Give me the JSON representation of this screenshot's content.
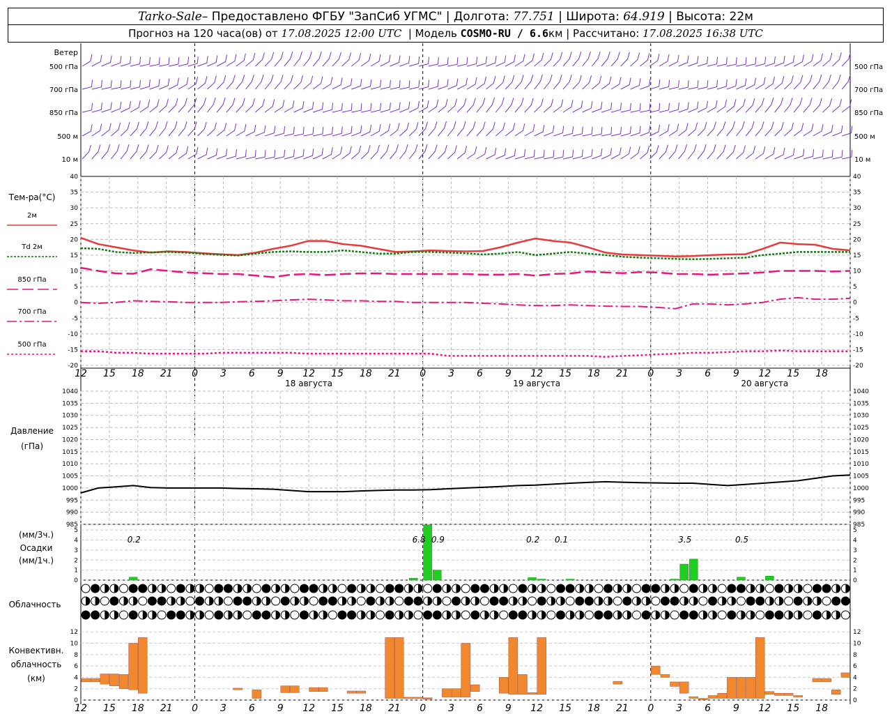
{
  "header": {
    "station": "Tarko-Sale",
    "provider": " – Предоставлено ФГБУ \"ЗапСиб УГМС\"",
    "lon_label": "Долгота:",
    "lon": "77.751",
    "lat_label": "Широта:",
    "lat": "64.919",
    "alt_label": "Высота:",
    "alt": "22м",
    "forecast_prefix": "Прогноз на 120 часа(ов) от",
    "forecast_time": "17.08.2025 12:00 UTC",
    "model_label": "Модель",
    "model": "COSMO-RU / 6.6",
    "model_unit": "км",
    "calc_label": "Рассчитано:",
    "calc_time": "17.08.2025 16:38 UTC"
  },
  "chart_data": [
    {
      "type": "wind-barbs",
      "title": "Ветер",
      "levels": [
        "500 гПа",
        "700 гПа",
        "850 гПа",
        "500 м",
        "10  м"
      ],
      "color": "#7733cc"
    },
    {
      "type": "line",
      "title": "Тем-ра(°C)",
      "ylim": [
        -20,
        40
      ],
      "yticks": [
        -20,
        -15,
        -10,
        -5,
        0,
        5,
        10,
        15,
        20,
        25,
        30,
        35,
        40
      ],
      "grid": true,
      "x_hours": [
        0,
        3,
        6,
        9,
        12,
        15,
        18,
        21,
        24,
        27,
        30,
        33,
        36,
        39,
        42,
        45,
        48,
        51,
        54,
        57,
        60,
        63,
        66,
        69,
        72,
        75,
        78,
        81,
        84,
        87,
        90,
        93,
        96,
        99,
        102,
        105,
        108,
        111,
        114,
        117,
        120
      ],
      "series": [
        {
          "name": "2м",
          "color": "#e83a3a",
          "values": [
            20.5,
            18.5,
            17.5,
            16.5,
            15.8,
            16.2,
            16,
            15.6,
            15.3,
            15,
            15.8,
            17,
            18,
            19.5,
            19.5,
            18.5,
            18,
            17,
            16,
            16.2,
            16.5,
            16.3,
            16.2,
            16.3,
            17.5,
            19,
            20.3,
            19.5,
            19,
            17.5,
            15.8,
            15.2,
            15,
            14.8,
            14.6,
            14.7,
            15,
            15.2,
            15.3,
            17,
            19,
            18.5,
            18.3,
            17,
            16.5
          ]
        },
        {
          "name": "Td  2м",
          "color": "#127a12",
          "values": [
            17.2,
            17,
            16,
            15.7,
            15.9,
            16,
            15.8,
            15.4,
            15.1,
            14.9,
            15.5,
            16,
            16.2,
            16,
            16,
            16.5,
            16,
            15.5,
            15.5,
            16,
            16,
            15.8,
            15.6,
            15.2,
            15.5,
            16,
            15,
            15.5,
            16,
            15.5,
            15,
            14.5,
            14.2,
            14,
            13.8,
            13.7,
            13.8,
            14,
            14.2,
            15,
            15.5,
            16,
            16,
            16,
            16
          ]
        },
        {
          "name": "850 гПа",
          "color": "#e8177f",
          "values": [
            11,
            10,
            9.2,
            9.1,
            10.5,
            10,
            9.5,
            9.3,
            9,
            9,
            8.5,
            8,
            8.8,
            9,
            8.7,
            9,
            9.2,
            9.2,
            9,
            9,
            9,
            9,
            9,
            8.8,
            8.8,
            9,
            8.5,
            9,
            9.2,
            9.8,
            9.5,
            9.3,
            9.6,
            9.5,
            9,
            9,
            8.8,
            9,
            9.2,
            9.5,
            10,
            10,
            10,
            9.8,
            10
          ]
        },
        {
          "name": "700 гПа",
          "color": "#e8177f",
          "values": [
            0,
            -0.3,
            0,
            0.5,
            0.3,
            0.2,
            0,
            0,
            0,
            0.2,
            0.3,
            0.5,
            0.8,
            1,
            0.8,
            0.5,
            0.5,
            0.3,
            0.3,
            0,
            0,
            0,
            0,
            -0.3,
            -0.5,
            -0.8,
            -1,
            -1,
            -0.8,
            -1,
            -1.2,
            -1.3,
            -1.3,
            -1.6,
            -2,
            -0.5,
            -0.5,
            -0.8,
            -0.5,
            0,
            1,
            1.5,
            1,
            1,
            1.3
          ]
        },
        {
          "name": "500 гПа",
          "color": "#e8177f",
          "values": [
            -15.5,
            -15.5,
            -16,
            -16,
            -16.3,
            -16.3,
            -16.3,
            -16.3,
            -16,
            -16,
            -16,
            -16,
            -16,
            -16.3,
            -16.3,
            -16.3,
            -16.3,
            -16.3,
            -16.3,
            -16.3,
            -16.3,
            -17,
            -17,
            -17,
            -17,
            -17,
            -17,
            -17,
            -17,
            -17,
            -17.3,
            -17,
            -16.8,
            -16.5,
            -16.3,
            -16,
            -16,
            -15.8,
            -15.5,
            -15.5,
            -15.3,
            -15.5,
            -15.5,
            -15.5,
            -15.5
          ]
        }
      ]
    },
    {
      "type": "line",
      "title": "Давление",
      "unit": "(гПа)",
      "ylim": [
        985,
        1040
      ],
      "yticks": [
        985,
        990,
        995,
        1000,
        1005,
        1010,
        1015,
        1020,
        1025,
        1030,
        1035,
        1040
      ],
      "grid": true,
      "series": [
        {
          "name": "Давление",
          "color": "#000000",
          "values": [
            998,
            1000,
            1000.5,
            1001,
            1000.2,
            1000,
            1000,
            1000,
            1000,
            999.8,
            999.7,
            999.5,
            999,
            998.5,
            998.5,
            998.5,
            998.8,
            999,
            999.2,
            999.2,
            999.3,
            999.7,
            1000,
            1000.3,
            1000.6,
            1001,
            1001.2,
            1001.6,
            1002,
            1002.3,
            1002.6,
            1002.4,
            1002.2,
            1002.1,
            1002,
            1002,
            1001.5,
            1001,
            1001.5,
            1002,
            1002.5,
            1003,
            1004,
            1005,
            1005.4
          ]
        }
      ]
    },
    {
      "type": "bar",
      "title": "Осадки",
      "unit_top": "(мм/3ч.)",
      "unit_bottom": "(мм/1ч.)",
      "ylim": [
        0,
        5.5
      ],
      "yticks": [
        0,
        1,
        2,
        3,
        4,
        5
      ],
      "color": "#22cc22",
      "bars": [
        [
          5,
          0.3
        ],
        [
          34.5,
          0.2
        ],
        [
          36,
          6.8
        ],
        [
          37,
          1
        ],
        [
          47,
          0.25
        ],
        [
          48,
          0.1
        ],
        [
          51,
          0.1
        ],
        [
          62,
          0.1
        ],
        [
          63,
          1.6
        ],
        [
          64,
          2.1
        ],
        [
          69,
          0.3
        ],
        [
          72,
          0.4
        ]
      ],
      "labels": [
        [
          "0.2",
          5.3
        ],
        [
          "6.8",
          35.3
        ],
        [
          "0.9",
          37.3
        ],
        [
          "0.2",
          47.3
        ],
        [
          "0.1",
          50.3
        ],
        [
          "3.5",
          63.3
        ],
        [
          "0.5",
          69.3
        ]
      ]
    },
    {
      "type": "symbols",
      "title": "Облачность"
    },
    {
      "type": "bar",
      "title": "Конвективн. облачность",
      "unit": "(км)",
      "ylim": [
        0,
        13.5
      ],
      "yticks": [
        0,
        2,
        4,
        6,
        8,
        10,
        12
      ],
      "color": "#f08830",
      "bars": [
        [
          0,
          3.2,
          3.8
        ],
        [
          1,
          3.2,
          3.8
        ],
        [
          2,
          2.8,
          4.6
        ],
        [
          3,
          2.5,
          4.6
        ],
        [
          4,
          2,
          4.5
        ],
        [
          5,
          1.8,
          10
        ],
        [
          6,
          1.2,
          11
        ],
        [
          16,
          1.8,
          2.1
        ],
        [
          18,
          0.3,
          1.8
        ],
        [
          21,
          1.3,
          2.5
        ],
        [
          22,
          1.3,
          2.5
        ],
        [
          24,
          1.5,
          2.2
        ],
        [
          25,
          1.5,
          2.2
        ],
        [
          28,
          1.2,
          1.6
        ],
        [
          29,
          1.2,
          1.6
        ],
        [
          32,
          0.3,
          11
        ],
        [
          33,
          0.3,
          11
        ],
        [
          34,
          0.3,
          0.5
        ],
        [
          35,
          0.3,
          0.5
        ],
        [
          36,
          0.3,
          0.4
        ],
        [
          38,
          0.5,
          2
        ],
        [
          39,
          0.5,
          2
        ],
        [
          40,
          0.5,
          10
        ],
        [
          41,
          1.5,
          2.7
        ],
        [
          44,
          1.2,
          4
        ],
        [
          45,
          1,
          11
        ],
        [
          46,
          1,
          4.5
        ],
        [
          47,
          1,
          1.3
        ],
        [
          48,
          1,
          11
        ],
        [
          56,
          2.8,
          3.3
        ],
        [
          60,
          4.5,
          6
        ],
        [
          61,
          4,
          4.5
        ],
        [
          62,
          2.4,
          3.2
        ],
        [
          63,
          1.2,
          3.2
        ],
        [
          64,
          0.3,
          0.6
        ],
        [
          65,
          0.3,
          0.3
        ],
        [
          66,
          0.3,
          0.8
        ],
        [
          67,
          0.3,
          1.2
        ],
        [
          68,
          0.3,
          4
        ],
        [
          69,
          0.3,
          4
        ],
        [
          70,
          0.3,
          4
        ],
        [
          71,
          0.3,
          11
        ],
        [
          72,
          1,
          1.5
        ],
        [
          73,
          0.8,
          1.2
        ],
        [
          74,
          0.8,
          1.2
        ],
        [
          75,
          0.5,
          0.8
        ],
        [
          77,
          3.2,
          3.8
        ],
        [
          78,
          3.2,
          3.8
        ],
        [
          79,
          1,
          1.8
        ],
        [
          80,
          4,
          4.8
        ]
      ]
    }
  ],
  "axis": {
    "hour_labels": [
      "12",
      "15",
      "18",
      "21",
      "0",
      "3",
      "6",
      "9",
      "12",
      "15",
      "18",
      "21",
      "0",
      "3",
      "6",
      "9",
      "12",
      "15",
      "18",
      "21",
      "0",
      "3",
      "6",
      "9",
      "12",
      "15",
      "18"
    ],
    "date_labels": [
      "18 августа",
      "19 августа",
      "20 августа"
    ]
  }
}
